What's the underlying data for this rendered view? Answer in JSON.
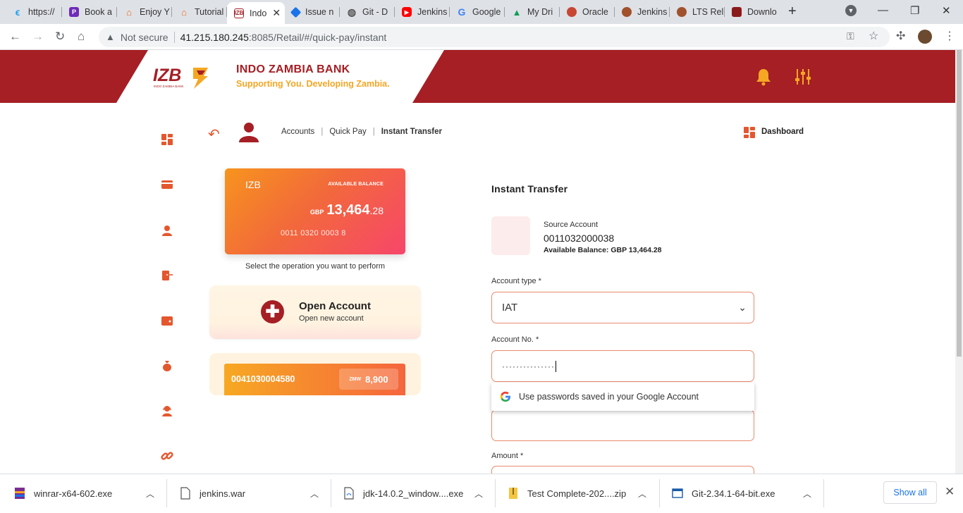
{
  "browser": {
    "tabs": [
      {
        "label": "https://",
        "color": "#1da1f2"
      },
      {
        "label": "Book a",
        "color": "#6e2bb8"
      },
      {
        "label": "Enjoy Y",
        "color": "#f26b1d"
      },
      {
        "label": "Tutorial",
        "color": "#f26b1d"
      },
      {
        "label": "Indo",
        "color": "#a51f24",
        "active": true
      },
      {
        "label": "Issue n",
        "color": "#1a73e8"
      },
      {
        "label": "Git - D",
        "color": "#555555"
      },
      {
        "label": "Jenkins",
        "color": "#ff0000"
      },
      {
        "label": "Google",
        "color": "#4285f4"
      },
      {
        "label": "My Dri",
        "color": "#0f9d58"
      },
      {
        "label": "Oracle",
        "color": "#c74634"
      },
      {
        "label": "Jenkins",
        "color": "#a0522d"
      },
      {
        "label": "LTS Rel",
        "color": "#a0522d"
      },
      {
        "label": "Downlo",
        "color": "#8b1a1a"
      }
    ],
    "security_label": "Not secure",
    "url_host": "41.215.180.245",
    "url_path": ":8085/Retail/#/quick-pay/instant"
  },
  "header": {
    "logo_text": "IZB",
    "logo_subtext": "INDO ZAMBIA BANK",
    "bank_name": "INDO ZAMBIA BANK",
    "tagline": "Supporting You. Developing Zambia."
  },
  "breadcrumb": {
    "items": [
      "Accounts",
      "Quick Pay",
      "Instant Transfer"
    ],
    "dashboard_label": "Dashboard"
  },
  "card": {
    "brand": "IZB",
    "available_label": "AVAILABLE BALANCE",
    "currency": "GBP",
    "balance_whole": "13,464",
    "balance_decimal": ".28",
    "account_number": "0011 0320 0003 8"
  },
  "operations": {
    "prompt": "Select the operation you want to perform",
    "open_account_title": "Open Account",
    "open_account_subtitle": "Open new account"
  },
  "account_strip": {
    "account_number": "0041030004580",
    "currency": "ZMW",
    "balance": "8,900"
  },
  "form": {
    "title": "Instant Transfer",
    "source_label": "Source Account",
    "source_account": "0011032000038",
    "available_balance": "Available Balance: GBP  13,464.28",
    "account_type_label": "Account type *",
    "account_type_value": "IAT",
    "account_no_label": "Account No. *",
    "account_no_value": "···············",
    "amount_label": "Amount *"
  },
  "autofill_popup": {
    "text": "Use passwords saved in your Google Account"
  },
  "downloads": {
    "items": [
      {
        "name": "winrar-x64-602.exe"
      },
      {
        "name": "jenkins.war"
      },
      {
        "name": "jdk-14.0.2_window....exe"
      },
      {
        "name": "Test Complete-202....zip"
      },
      {
        "name": "Git-2.34.1-64-bit.exe"
      }
    ],
    "show_all_label": "Show all"
  },
  "colors": {
    "brand_red": "#a51f24",
    "accent_orange": "#e4572e",
    "tagline_yellow": "#f5a623"
  }
}
